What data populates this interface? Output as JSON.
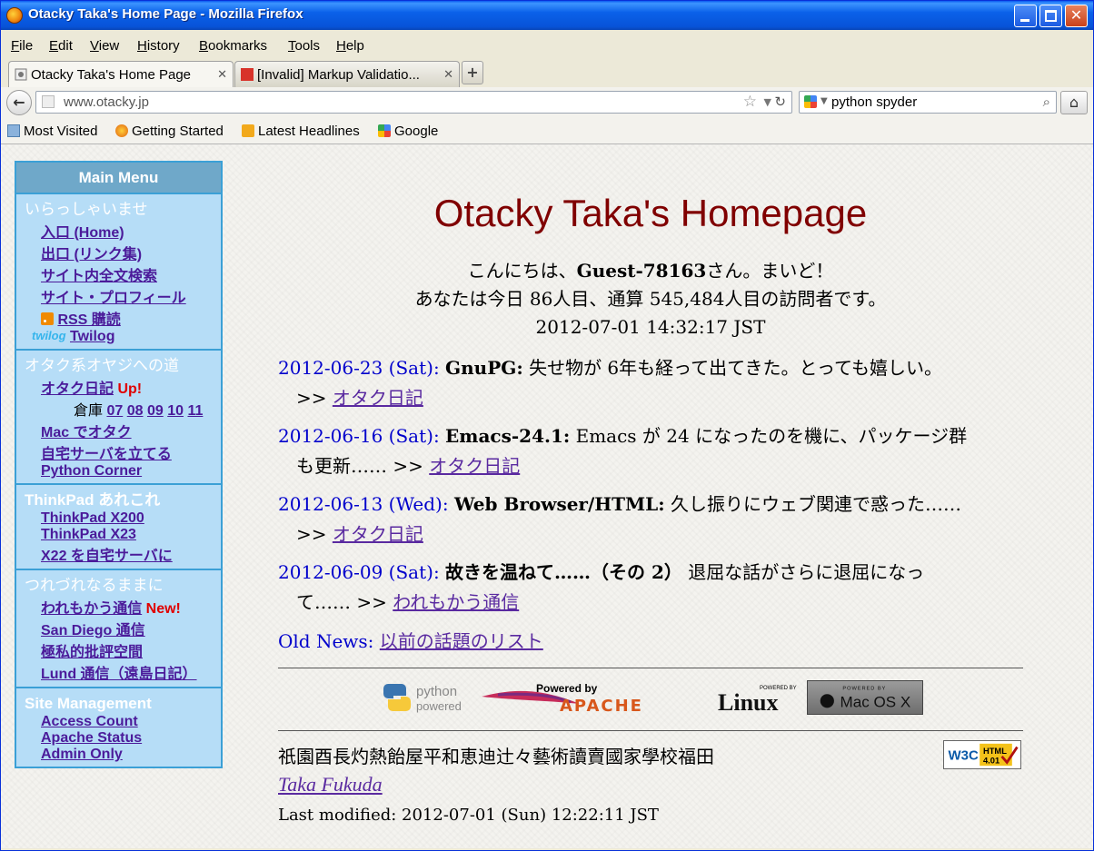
{
  "window": {
    "title": "Otacky Taka's Home Page - Mozilla Firefox"
  },
  "menu": {
    "items": [
      "File",
      "Edit",
      "View",
      "History",
      "Bookmarks",
      "Tools",
      "Help"
    ]
  },
  "tabs": [
    {
      "label": "Otacky Taka's Home Page",
      "active": true
    },
    {
      "label": "[Invalid] Markup Validatio...",
      "active": false
    }
  ],
  "nav": {
    "url": "www.otacky.jp",
    "search": "python spyder"
  },
  "bookmarks": [
    "Most Visited",
    "Getting Started",
    "Latest Headlines",
    "Google"
  ],
  "sidebar": {
    "title": "Main Menu",
    "sections": [
      {
        "title": "いらっしゃいませ",
        "items": [
          "入口 (Home)",
          "出口 (リンク集)",
          "サイト内全文検索",
          "サイト・プロフィール",
          "RSS 購読",
          "Twilog"
        ],
        "twilog_logo": "twilog"
      },
      {
        "title": "オタク系オヤジへの道",
        "items": [
          "オタク日記",
          "Mac でオタク",
          "自宅サーバを立てる",
          "Python Corner"
        ],
        "up_tag": "Up!",
        "warehouse_label": "倉庫",
        "warehouse_links": [
          "07",
          "08",
          "09",
          "10",
          "11"
        ]
      },
      {
        "title": "ThinkPad あれこれ",
        "items": [
          "ThinkPad X200",
          "ThinkPad X23",
          "X22 を自宅サーバに"
        ]
      },
      {
        "title": "つれづれなるままに",
        "items": [
          "われもかう通信",
          "San Diego 通信",
          "極私的批評空間",
          "Lund 通信（遠島日記）"
        ],
        "new_tag": "New!"
      },
      {
        "title": "Site Management",
        "items": [
          "Access Count",
          "Apache Status",
          "Admin Only"
        ]
      }
    ]
  },
  "main": {
    "title": "Otacky Taka's Homepage",
    "greeting": {
      "line1_pre": "こんにちは、",
      "guest": "Guest-78163",
      "line1_post": "さん。まいど！",
      "line2": "あなたは今日 86人目、通算 545,484人目の訪問者です。",
      "line3": "2012-07-01 14:32:17 JST"
    },
    "news": [
      {
        "date": "2012-06-23 (Sat):",
        "head": "GnuPG:",
        "body": " 失せ物が 6年も経って出てきた。とっても嬉しい。",
        "body2": "",
        "link": "オタク日記"
      },
      {
        "date": "2012-06-16 (Sat):",
        "head": "Emacs-24.1:",
        "body": " Emacs が 24 になったのを機に、パッケージ群",
        "body2": "も更新…… ",
        "link": "オタク日記"
      },
      {
        "date": "2012-06-13 (Wed):",
        "head": "Web Browser/HTML:",
        "body": " 久し振りにウェブ関連で惑った……",
        "body2": "",
        "link": "オタク日記"
      },
      {
        "date": "2012-06-09 (Sat):",
        "head": "故きを温ねて……（その 2）",
        "body": " 退屈な話がさらに退屈になっ",
        "body2": "て…… ",
        "link": "われもかう通信"
      }
    ],
    "arrow": ">>",
    "old_news_label": "Old News:",
    "old_news_link": "以前の話題のリスト",
    "badges": {
      "python": [
        "python",
        "powered"
      ],
      "apache": [
        "Powered by",
        "APACHE"
      ],
      "linux": [
        "POWERED BY",
        "Linux"
      ],
      "mac": [
        "POWERED BY",
        "Mac OS X"
      ],
      "w3c": [
        "W3C",
        "HTML",
        "4.01"
      ]
    },
    "footer_jp": "祇園酉長灼熱飴屋平和恵迪辻々藝術讀賣國家學校福田",
    "author": "Taka Fukuda",
    "last_modified": "Last modified: 2012-07-01 (Sun) 12:22:11 JST"
  },
  "colors": {
    "sidebar_bg": "#b6ddf7",
    "sidebar_border": "#3ba0d6",
    "title": "#800000",
    "date": "#0000cc",
    "link": "#5a2aa0"
  }
}
